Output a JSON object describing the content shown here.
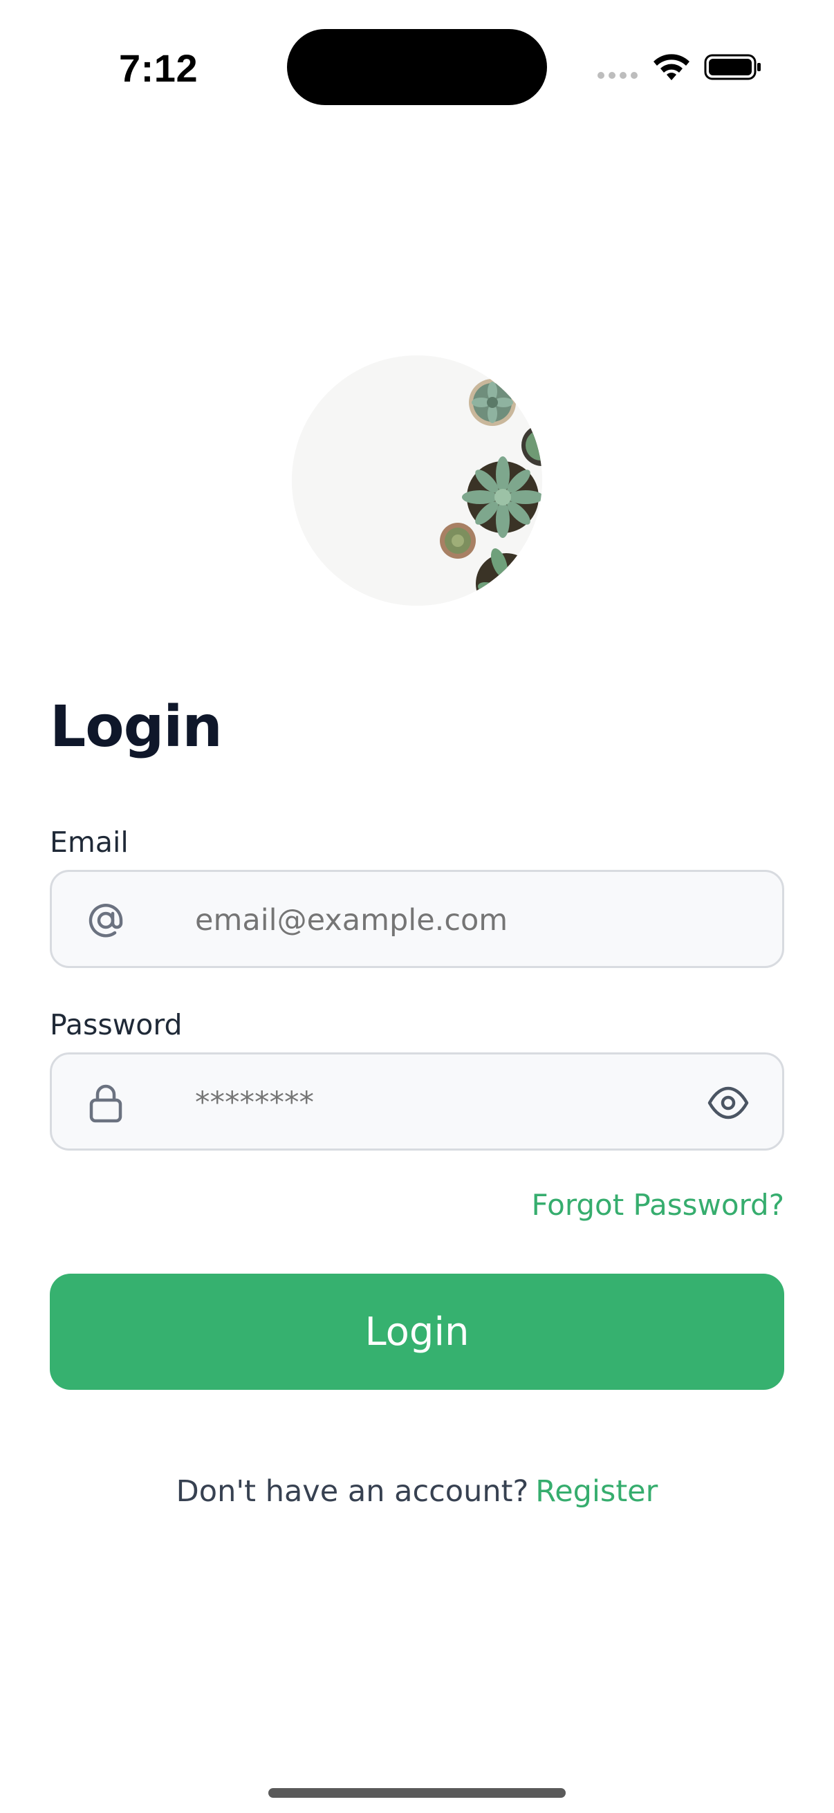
{
  "status_bar": {
    "time": "7:12"
  },
  "colors": {
    "accent": "#36b16f",
    "link": "#36ad6e",
    "title": "#0f172a",
    "input_bg": "#f8f9fb",
    "input_border": "#d8dbe0"
  },
  "page": {
    "title": "Login"
  },
  "email": {
    "label": "Email",
    "placeholder": "email@example.com",
    "icon": "at-icon"
  },
  "password": {
    "label": "Password",
    "placeholder": "********",
    "icon": "lock-icon",
    "toggle_icon": "eye-icon"
  },
  "forgot_password": {
    "label": "Forgot Password?"
  },
  "login_button": {
    "label": "Login"
  },
  "register": {
    "prompt": "Don't have an account?",
    "link": "Register"
  }
}
